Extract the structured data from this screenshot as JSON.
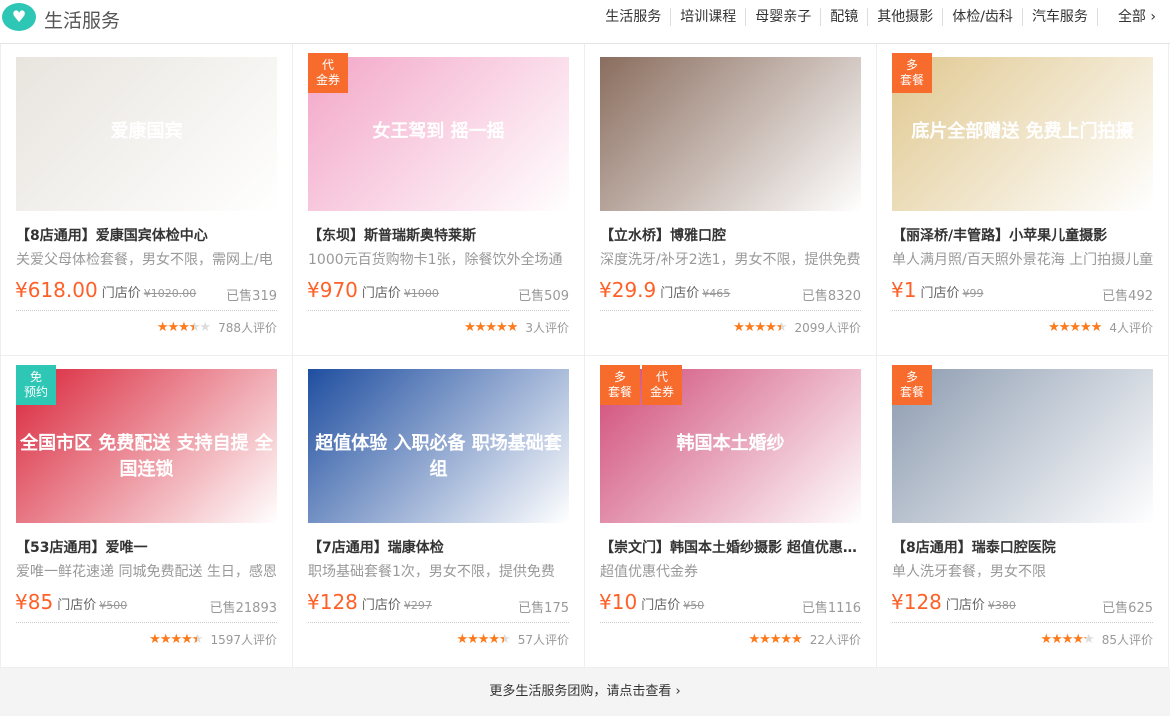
{
  "header": {
    "title": "生活服务",
    "nav": [
      "生活服务",
      "培训课程",
      "母婴亲子",
      "配镜",
      "其他摄影",
      "体检/齿科",
      "汽车服务",
      "全部 ›"
    ]
  },
  "store_label": "门店价",
  "cards": [
    {
      "badges": [],
      "img_text": "爱康国宾",
      "img_color": "#e8e4de",
      "title": "【8店通用】爱康国宾体检中心",
      "desc": "关爱父母体检套餐，男女不限，需网上/电",
      "price": "¥618.00",
      "orig": "¥1020.00",
      "sold": "已售319",
      "rating": 3.5,
      "reviews": "788人评价"
    },
    {
      "badges": [
        "代\n金券"
      ],
      "img_text": "女王驾到 摇一摇",
      "img_color": "#f3a6c8",
      "title": "【东坝】斯普瑞斯奥特莱斯",
      "desc": "1000元百货购物卡1张，除餐饮外全场通",
      "price": "¥970",
      "orig": "¥1000",
      "sold": "已售509",
      "rating": 5,
      "reviews": "3人评价"
    },
    {
      "badges": [],
      "img_text": "",
      "img_color": "#8a6d5e",
      "title": "【立水桥】博雅口腔",
      "desc": "深度洗牙/补牙2选1，男女不限，提供免费",
      "price": "¥29.9",
      "orig": "¥465",
      "sold": "已售8320",
      "rating": 4.5,
      "reviews": "2099人评价"
    },
    {
      "badges": [
        "多\n套餐"
      ],
      "img_text": "底片全部赠送 免费上门拍摄",
      "img_color": "#e0c890",
      "title": "【丽泽桥/丰管路】小苹果儿童摄影",
      "desc": "单人满月照/百天照外景花海 上门拍摄儿童",
      "price": "¥1",
      "orig": "¥99",
      "sold": "已售492",
      "rating": 5,
      "reviews": "4人评价"
    },
    {
      "badges": [
        "免\n预约"
      ],
      "img_text": "全国市区 免费配送 支持自提 全国连锁",
      "img_color": "#d9253a",
      "title": "【53店通用】爱唯一",
      "desc": "爱唯一鲜花速递 同城免费配送 生日，感恩",
      "price": "¥85",
      "orig": "¥500",
      "sold": "已售21893",
      "rating": 4.5,
      "reviews": "1597人评价"
    },
    {
      "badges": [],
      "img_text": "超值体验 入职必备 职场基础套组",
      "img_color": "#1f4ea0",
      "title": "【7店通用】瑞康体检",
      "desc": "职场基础套餐1次，男女不限，提供免费",
      "price": "¥128",
      "orig": "¥297",
      "sold": "已售175",
      "rating": 4.5,
      "reviews": "57人评价"
    },
    {
      "badges": [
        "多\n套餐",
        "代\n金券"
      ],
      "img_text": "韩国本土婚纱",
      "img_color": "#d04a78",
      "title": "【崇文门】韩国本土婚纱摄影 超值优惠代金券",
      "desc": "超值优惠代金券",
      "price": "¥10",
      "orig": "¥50",
      "sold": "已售1116",
      "rating": 5,
      "reviews": "22人评价"
    },
    {
      "badges": [
        "多\n套餐"
      ],
      "img_text": "",
      "img_color": "#8c9bb0",
      "title": "【8店通用】瑞泰口腔医院",
      "desc": "单人洗牙套餐，男女不限",
      "price": "¥128",
      "orig": "¥380",
      "sold": "已售625",
      "rating": 4.3,
      "reviews": "85人评价"
    }
  ],
  "footer": "更多生活服务团购，请点击查看 ›"
}
